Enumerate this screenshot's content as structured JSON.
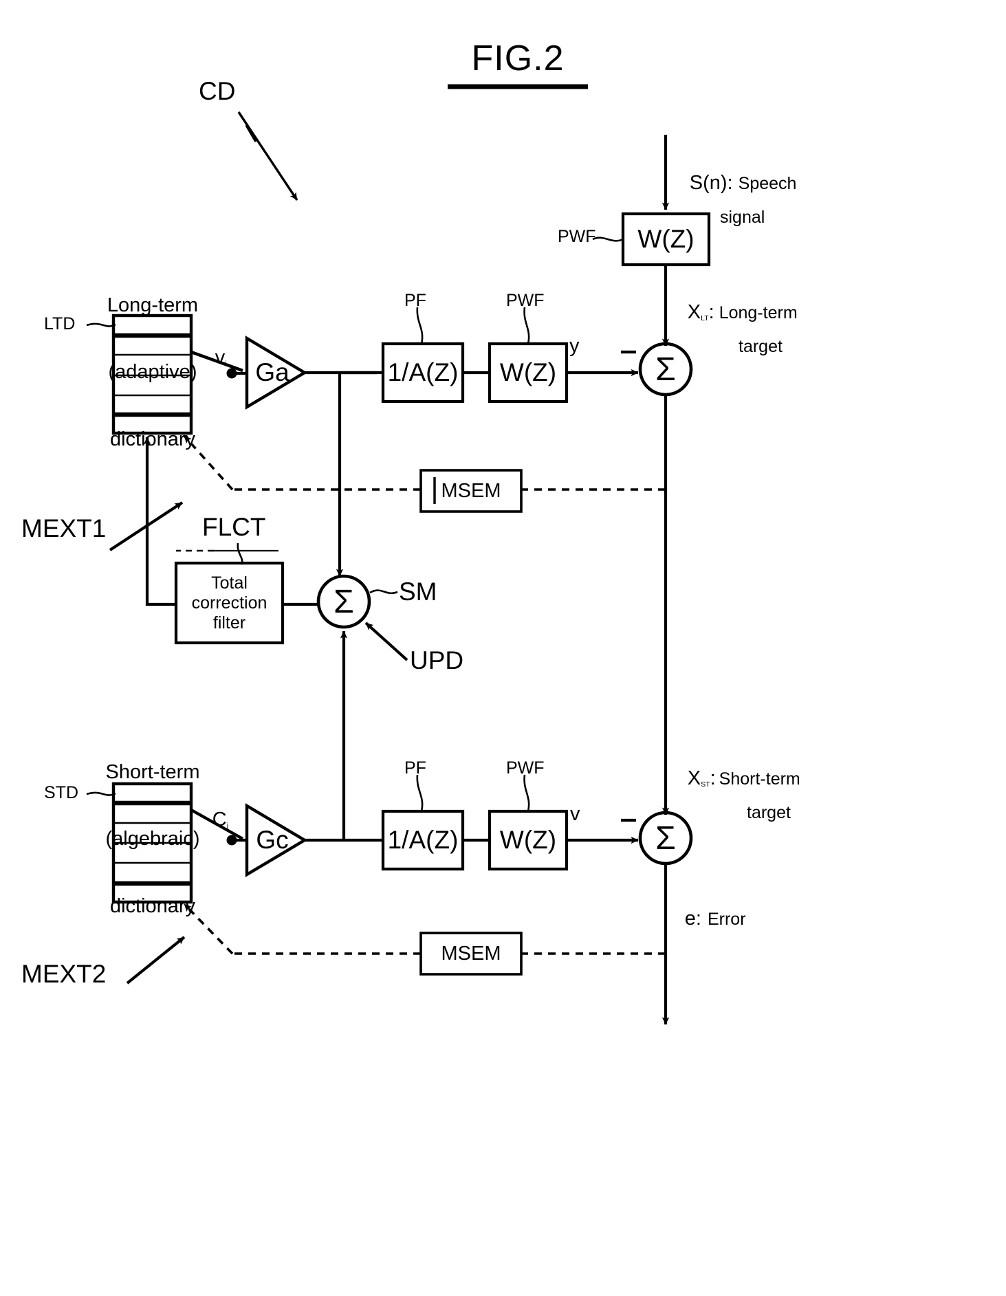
{
  "figure": {
    "title": "FIG.2",
    "type": "patent-block-diagram",
    "description": "CELP speech coder analysis-by-synthesis block diagram with long-term (adaptive) and short-term (algebraic) dictionaries"
  },
  "colors": {
    "ink": "#000000",
    "paper": "#ffffff"
  },
  "callouts": {
    "cd": "CD",
    "ltd": "LTD",
    "std": "STD",
    "mext1": "MEXT1",
    "mext2": "MEXT2",
    "flct": "FLCT",
    "sm": "SM",
    "upd": "UPD"
  },
  "dictionaries": {
    "long_term": {
      "caption_line1": "Long-term",
      "caption_line2": "(adaptive)",
      "caption_line3": "dictionary",
      "tag": "LTD",
      "output_label": "v",
      "output_sub": "i"
    },
    "short_term": {
      "caption_line1": "Short-term",
      "caption_line2": "(algebraic)",
      "caption_line3": "dictionary",
      "tag": "STD",
      "output_label": "C",
      "output_sub": "j"
    }
  },
  "gains": {
    "long_term": "Ga",
    "short_term": "Gc"
  },
  "filters": {
    "synthesis_label": "1/A(Z)",
    "weighting_label": "W(Z)",
    "synthesis_tag": "PF",
    "weighting_tag": "PWF"
  },
  "input_filter": {
    "label": "W(Z)",
    "tag": "PWF"
  },
  "correction_filter": {
    "line1": "Total",
    "line2": "correction",
    "line3": "filter",
    "tag": "FLCT"
  },
  "minimizers": {
    "top": "MSEM",
    "bottom": "MSEM"
  },
  "signals": {
    "input": {
      "symbol": "S(n)",
      "colon": ":",
      "text_line1": "Speech",
      "text_line2": "signal"
    },
    "long_term_target": {
      "symbol": "X",
      "sub": "LT",
      "colon": ":",
      "text_line1": "Long-term",
      "text_line2": "target"
    },
    "short_term_target": {
      "symbol": "X",
      "sub": "ST",
      "colon": ":",
      "text_line1": "Short-term",
      "text_line2": "target"
    },
    "error": {
      "symbol": "e",
      "colon": ":",
      "text": "Error"
    },
    "lt_synth_out": "y",
    "st_synth_out": "v"
  },
  "adders": {
    "long_term_sum": {
      "glyph": "Σ",
      "sign": "-"
    },
    "short_term_sum": {
      "glyph": "Σ",
      "sign": "-"
    },
    "excitation_sum": {
      "glyph": "Σ"
    }
  }
}
